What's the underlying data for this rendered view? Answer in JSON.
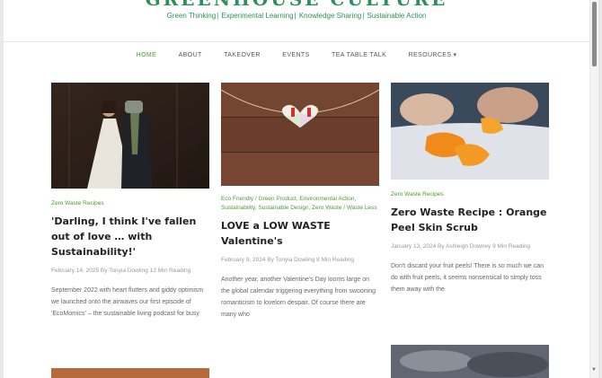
{
  "site": {
    "title": "GREENHOUSE CULTURE",
    "tagline": [
      "Green Thinking",
      "Experimental Learning",
      "Knowledge Sharing",
      "Sustainable Action"
    ]
  },
  "nav": {
    "items": [
      "HOME",
      "ABOUT",
      "TAKEOVER",
      "EVENTS",
      "TEA TABLE TALK",
      "RESOURCES"
    ],
    "active": "HOME"
  },
  "posts": [
    {
      "category": "Zero Waste Recipes",
      "title": "'Darling, I think I've fallen out of love … with Sustainability!'",
      "meta": "February 14, 2025   By Tonyia Dowling   12 Min Reading",
      "excerpt": "September 2022 with heart flutters and giddy optimism we launched onto the airwaves our first episode of 'EcoMomics' – the sustainable living podcast for busy"
    },
    {
      "category": "Eco Friendly / Green Product, Environmental Action, Sustainability, Sustainable Design, Zero Waste / Waste Less",
      "title": "LOVE a LOW WASTE Valentine's",
      "meta": "February 9, 2024   By Tonyia Dowling   8 Min Reading",
      "excerpt": "Another year, another Valentine's Day looms large on the global calendar triggering everything from swooning romanticism to lovelorn despair. Of course there are many who"
    },
    {
      "category": "Zero Waste Recipes",
      "title": "Zero Waste Recipe : Orange Peel Skin Scrub",
      "meta": "January 13, 2024   By Ashleigh Downey   9 Min Reading",
      "excerpt": "Don't discard your fruit peels! There is so much we can do with fruit peels, it seems nonsensical to simply toss them away with the"
    }
  ]
}
